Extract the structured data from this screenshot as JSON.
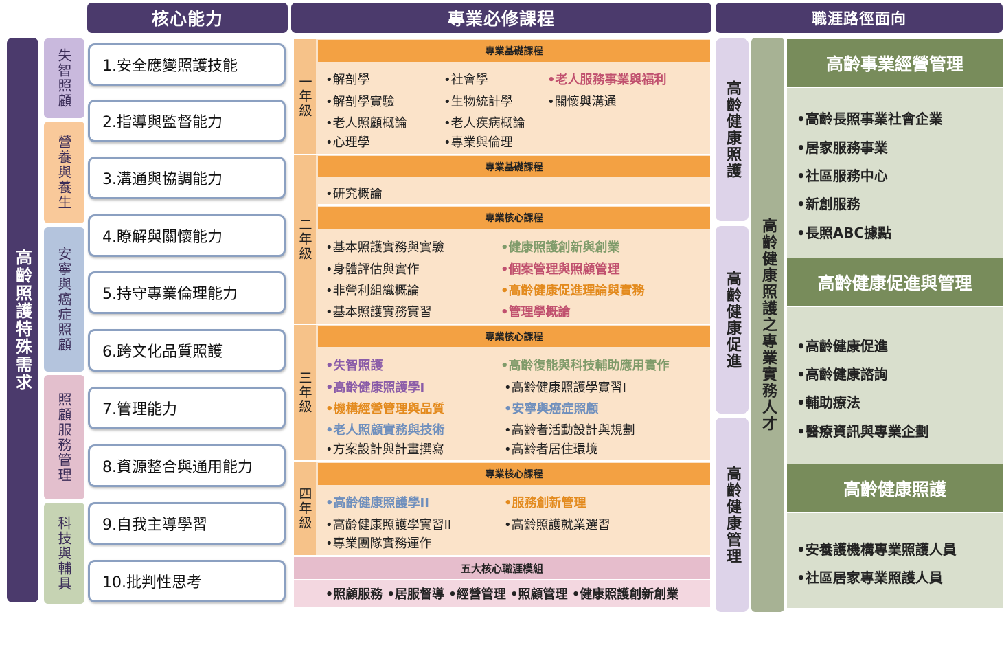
{
  "headers": {
    "core": "核心能力",
    "courses": "專業必修課程",
    "career": "職涯路徑面向"
  },
  "left_column": "高齡照護特殊需求",
  "categories": [
    {
      "label": "失智照顧",
      "color": "#c9b9dd"
    },
    {
      "label": "營養與養生",
      "color": "#f9c99a"
    },
    {
      "label": "安寧與癌症照顧",
      "color": "#b4c4dd"
    },
    {
      "label": "照顧服務管理",
      "color": "#e3bfcd"
    },
    {
      "label": "科技與輔具",
      "color": "#c6d3b3"
    }
  ],
  "competencies": [
    "1.安全應變照護技能",
    "2.指導與監督能力",
    "3.溝通與協調能力",
    "4.瞭解與關懷能力",
    "5.持守專業倫理能力",
    "6.跨文化品質照護",
    "7.管理能力",
    "8.資源整合與通用能力",
    "9.自我主導學習",
    "10.批判性思考"
  ],
  "course_colors": {
    "purple": "#8a5ca8",
    "pink": "#c0506e",
    "orange": "#e38a1d",
    "green": "#7f9b6a",
    "blue": "#6f8fbd"
  },
  "years": {
    "y1": {
      "label": "一年級",
      "section": "專業基礎課程",
      "courses": [
        {
          "text": "•解剖學",
          "color": "",
          "bold": false
        },
        {
          "text": "•解剖學實驗",
          "color": "",
          "bold": false
        },
        {
          "text": "•老人照顧概論",
          "color": "",
          "bold": false
        },
        {
          "text": "•心理學",
          "color": "",
          "bold": false
        },
        {
          "text": "•社會學",
          "color": "",
          "bold": false
        },
        {
          "text": "•生物統計學",
          "color": "",
          "bold": false
        },
        {
          "text": "•老人疾病概論",
          "color": "",
          "bold": false
        },
        {
          "text": "•專業與倫理",
          "color": "",
          "bold": false
        },
        {
          "text": "•老人服務事業與福利",
          "color": "pink",
          "bold": true
        },
        {
          "text": "•關懷與溝通",
          "color": "",
          "bold": false
        }
      ]
    },
    "y2": {
      "label": "二年級",
      "section_a": "專業基礎課程",
      "courses_a": [
        {
          "text": "•研究概論",
          "color": "",
          "bold": false
        }
      ],
      "section_b": "專業核心課程",
      "courses_b": [
        {
          "text": "•基本照護實務與實驗",
          "color": "",
          "bold": false
        },
        {
          "text": "•身體評估與實作",
          "color": "",
          "bold": false
        },
        {
          "text": "•非營利組織概論",
          "color": "",
          "bold": false
        },
        {
          "text": "•基本照護實務實習",
          "color": "",
          "bold": false
        },
        {
          "text": "•健康照護創新與創業",
          "color": "green",
          "bold": true
        },
        {
          "text": "•個案管理與照顧管理",
          "color": "pink",
          "bold": true
        },
        {
          "text": "•高齡健康促進理論與實務",
          "color": "orange",
          "bold": true
        },
        {
          "text": "•管理學概論",
          "color": "pink",
          "bold": true
        }
      ]
    },
    "y3": {
      "label": "三年級",
      "section": "專業核心課程",
      "courses": [
        {
          "text": "•失智照護",
          "color": "purple",
          "bold": true
        },
        {
          "text": "•高齡健康照護學I",
          "color": "purple",
          "bold": true
        },
        {
          "text": "•機構經營管理與品質",
          "color": "orange",
          "bold": true
        },
        {
          "text": "•老人照顧實務與技術",
          "color": "blue",
          "bold": true
        },
        {
          "text": "•方案設計與計畫撰寫",
          "color": "",
          "bold": false
        },
        {
          "text": "•高齡復能與科技輔助應用實作",
          "color": "green",
          "bold": true
        },
        {
          "text": "•高齡健康照護學實習I",
          "color": "",
          "bold": false
        },
        {
          "text": "•安寧與癌症照顧",
          "color": "blue",
          "bold": true
        },
        {
          "text": "•高齡者活動設計與規劃",
          "color": "",
          "bold": false
        },
        {
          "text": "•高齡者居住環境",
          "color": "",
          "bold": false
        }
      ]
    },
    "y4": {
      "label": "四年級",
      "section": "專業核心課程",
      "courses": [
        {
          "text": "•高齡健康照護學II",
          "color": "blue",
          "bold": true
        },
        {
          "text": "•高齡健康照護學實習II",
          "color": "",
          "bold": false
        },
        {
          "text": "•專業團隊實務運作",
          "color": "",
          "bold": false
        },
        {
          "text": "•服務創新管理",
          "color": "orange",
          "bold": true
        },
        {
          "text": "•高齡照護就業選習",
          "color": "",
          "bold": false
        }
      ]
    }
  },
  "modules": {
    "title": "五大核心職涯模組",
    "items": "•照顧服務 •居服督導 •經營管理 •照顧管理 •健康照護創新創業"
  },
  "career_paths": [
    "高齡健康照護",
    "高齡健康促進",
    "高齡健康管理"
  ],
  "talent": "高齡健康照護之專業實務人才",
  "career_groups": [
    {
      "title": "高齡事業經營管理",
      "items": [
        "•高齡長照事業社會企業",
        "•居家服務事業",
        "•社區服務中心",
        "•新創服務",
        "•長照ABC據點"
      ]
    },
    {
      "title": "高齡健康促進與管理",
      "items": [
        "•高齡健康促進",
        "•高齡健康諮詢",
        "•輔助療法",
        "•醫療資訊與專業企劃"
      ]
    },
    {
      "title": "高齡健康照護",
      "items": [
        "•安養護機構專業照護人員",
        "•社區居家專業照護人員"
      ]
    }
  ]
}
